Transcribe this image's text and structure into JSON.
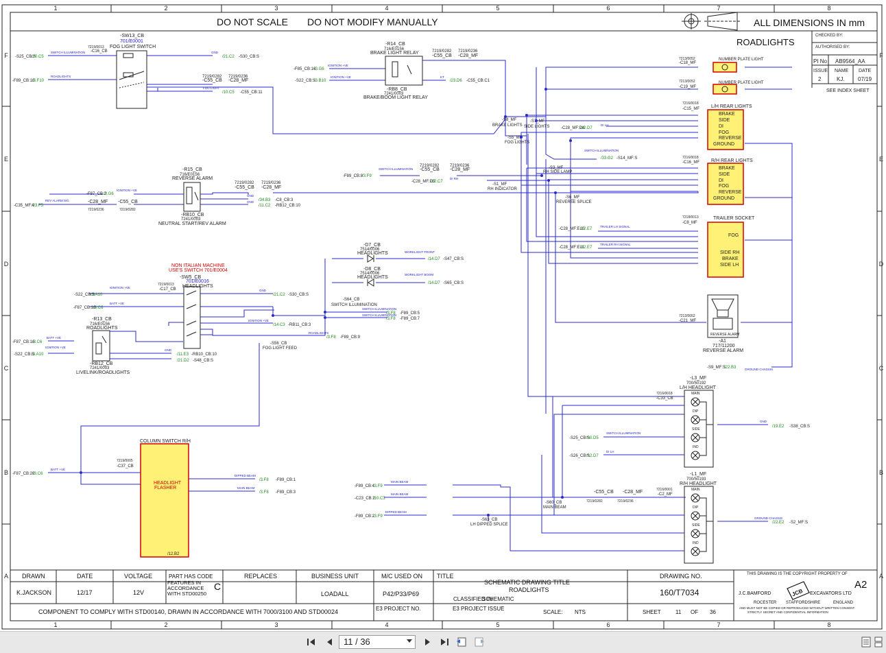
{
  "grid": {
    "cols": [
      "1",
      "2",
      "3",
      "4",
      "5",
      "6",
      "7",
      "8"
    ],
    "rows": [
      "F",
      "E",
      "D",
      "C",
      "B",
      "A"
    ]
  },
  "header": {
    "do_not_scale": "DO NOT SCALE",
    "do_not_modify": "DO NOT MODIFY MANUALLY",
    "all_dims": "ALL DIMENSIONS IN mm"
  },
  "sheet_title": "ROADLIGHTS",
  "right_panel": {
    "checked_by": "CHECKED BY:",
    "authorised_by": "AUTHORISED BY:",
    "pi_no_label": "PI No",
    "pi_no": "AB9564_AA",
    "issue_label": "ISSUE",
    "name_label": "NAME",
    "date_label": "DATE",
    "issue": "2",
    "name": "KJ.",
    "date": "07/19",
    "see_index": "SEE INDEX SHEET"
  },
  "components": {
    "sw13": {
      "ref": "-SW13_CB",
      "part": "701/E0001",
      "name": "FOG LIGHT SWITCH",
      "conn": "7219/0013",
      "plug": "-C16_CB"
    },
    "r14": {
      "ref": "-R14_CB",
      "part": "716/E0156",
      "name": "BRAKE LIGHT RELAY",
      "plug": "-RB8_CB",
      "part2": "7241/0003",
      "name2": "BRAKE/BOOM LIGHT RELAY"
    },
    "r15": {
      "ref": "-R15_CB",
      "part": "716/E0156",
      "name": "REVERSE ALARM",
      "plug": "-RB10_CB",
      "part2": "7241/0003",
      "name2": "NEUTRAL START/REV ALARM"
    },
    "sw5": {
      "ref": "-SW5_CB",
      "part": "701/E0016",
      "name": "HEADLIGHTS",
      "conn": "7219/0013",
      "plug": "-C17_CB",
      "note1": "NON ITALIAN MACHINE",
      "note2": "USE'S SWITCH 701/E0004"
    },
    "r13": {
      "ref": "-R13_CB",
      "part": "716/E0156",
      "name": "ROADLIGHTS",
      "plug": "-RB12_CB",
      "part2": "7241/0003",
      "name2": "LIVELINK/ROADLIGHTS"
    },
    "d7": {
      "ref": "-D7_CB",
      "part": "7514/0006",
      "name": "HEADLIGHTS"
    },
    "d8": {
      "ref": "-D8_CB",
      "part": "7514/0006",
      "name": "HEADLIGHTS"
    },
    "col_switch": {
      "title": "COLUMN SWITCH R/H",
      "name1": "HEADLIGHT",
      "name2": "FLASHER",
      "ref": "/12.B2",
      "conn": "7219/0005",
      "plug": "-C37_CB"
    },
    "c18": {
      "ref": "-C18_MF",
      "conn": "7213/0052",
      "name": "NUMBER PLATE LIGHT"
    },
    "c19": {
      "ref": "-C19_MF",
      "conn": "7213/0052",
      "name": "NUMBER PLATE LIGHT"
    },
    "c15": {
      "ref": "-C15_MF",
      "conn": "7216/0018",
      "name": "L/H REAR LIGHTS",
      "pins": [
        "BRAKE",
        "SIDE",
        "DI",
        "FOG",
        "REVERSE",
        "GROUND"
      ]
    },
    "c16": {
      "ref": "-C16_MF",
      "conn": "7216/0018",
      "name": "R/H REAR LIGHTS",
      "pins": [
        "BRAKE",
        "SIDE",
        "DI",
        "FOG",
        "REVERSE",
        "GROUND"
      ]
    },
    "c8": {
      "ref": "-C8_MF",
      "conn": "7218/0013",
      "name": "TRAILER SOCKET",
      "pins": [
        "FOG",
        "SIDE RH",
        "BRAKE",
        "SIDE LH"
      ]
    },
    "a1": {
      "ref": "-A1",
      "part": "717/11200",
      "name": "REVERSE ALARM",
      "conn": "7212/0052",
      "plug": "-C21_MF",
      "label": "REVERSE ALARM"
    },
    "l3": {
      "ref": "-L3_MF",
      "part": "700/50192",
      "name": "L/H HEADLIGHT",
      "conn": "7216/0018",
      "plug": "-C33_CB",
      "pins": [
        "MAIN",
        "DIP",
        "SIDE",
        "IND"
      ]
    },
    "l1": {
      "ref": "-L1_MF",
      "part": "700/50193",
      "name": "R/H HEADLIGHT",
      "conn": "7216/0001",
      "plug": "-C2_MF",
      "pins": [
        "MAIN",
        "DIP",
        "SIDE",
        "IND"
      ]
    }
  },
  "splices": {
    "s8": "-S8_MF",
    "s8n": "BRAKE LIGHTS",
    "s7": "-S7_MF",
    "s7n": "SIDE LIGHTS",
    "s5": "-S5_MF",
    "s5n": "FOG LIGHTS",
    "s3": "-S3_MF",
    "s3n": "RH SIDE LAMP",
    "s1": "-S1_MF",
    "s1n": "RH INDICATOR",
    "s6": "-S6_MF",
    "s6n": "REVERSE SPLICE",
    "s64": "-S64_CB",
    "s64n": "SWITCH ILLUMINATION",
    "s56": "-S56_CB",
    "s56n": "FOG LIGHT FEED",
    "s60": "-S60_CB",
    "s60n": "MAIN BEAM",
    "s63": "-S63_CB",
    "s63n": "LH DIPPED SPLICE"
  },
  "xrefs": {
    "f_a": "-S25_CB:S",
    "f_a2": "/20.C5",
    "f_b": "-F89_CB:10",
    "f_b2": "/3.F10",
    "f_c": "/21.C2",
    "f_c2": "-S30_CB:S",
    "f_d": "/10.C5",
    "f_d2": "-C55_CB:11",
    "f_e": "-F85_CB:16",
    "f_e2": "/3.G6",
    "f_f": "-S22_CB:S",
    "f_f2": "/3.B10",
    "f_g": "/23.D6",
    "f_g2": "-C55_CB:C1",
    "e_a": "-F89_CB:8",
    "e_a2": "/3.F9",
    "e_b": "-C28_MF:D4",
    "e_b2": "/12.D7",
    "e_c": "/33.G2",
    "e_c2": "-S14_MF:S",
    "e_d": "-C28_MF:D3",
    "e_d2": "/12.C7",
    "e_e": "-F87_CB:2",
    "e_e2": "/3.G6",
    "e_f": "-C35_MF:4",
    "e_f2": "/23.F5",
    "e_g": "/34.B3",
    "e_g2": "-C8_CB:3",
    "e_h": "/11.C2",
    "e_h2": "-RB12_CB:10",
    "d_a": "-C28_MF:E10",
    "d_a2": "/12.E7",
    "d_b": "-C28_MF:E11",
    "d_b2": "/12.E7",
    "d_c": "/14.D7",
    "d_c2": "-S47_CB:S",
    "d_d": "/14.D7",
    "d_d2": "-S65_CB:S",
    "c_a": "-S22_CB:S",
    "c_a2": "/3.A10",
    "c_b": "-F87_CB:16",
    "c_b2": "/3.C6",
    "c_c": "/21.C2",
    "c_c2": "-S30_CB:S",
    "c_d": "/14.C3",
    "c_d2": "-RB11_CB:3",
    "c_e": "/3.F8",
    "c_e2": "-F89_CB:9",
    "c_f": "-F87_CB:16",
    "c_f2": "/3.C6",
    "c_g": "-S22_CB:S",
    "c_g2": "/3.A10",
    "c_h": "/11.E3",
    "c_h2": "-RB10_CB:10",
    "c_i": "/21.D2",
    "c_i2": "-S48_CB:S",
    "c_j": "/3.F8",
    "c_j2": "-F89_CB:5",
    "c_k": "/3.F8",
    "c_k2": "-F89_CB:7",
    "c_l": "-S9_MF:S",
    "c_l2": "/22.B3",
    "b_a": "-S25_CB:S",
    "b_a2": "/20.D5",
    "b_b": "-S26_CB:S",
    "b_b2": "/12.D7",
    "b_c": "/19.E2",
    "b_c2": "-S38_CB:S",
    "b_d": "-F87_CB:20",
    "b_d2": "/3.C6",
    "b_e": "/3.F8",
    "b_e2": "-F89_CB:1",
    "b_f": "/3.F8",
    "b_f2": "-F89_CB:3",
    "b_g": "-F89_CB:4",
    "b_g2": "/3.F9",
    "b_h": "-C23_CB:2",
    "b_h2": "/10.C3",
    "b_i": "-F89_CB:2",
    "b_i2": "/3.F9",
    "b_j": "/22.E2",
    "b_j2": "-S2_MF:S",
    "c55": "-C55_CB",
    "c55c": "7219/0282",
    "c28": "-C28_MF",
    "c28c": "7219/0236"
  },
  "wire_notes": {
    "switch_illum": "SWITCH ILLUMINATION",
    "roadlights": "ROADLIGHTS",
    "gnd": "GND",
    "fog_light": "FOG LIGHT",
    "ignition": "IGNITION +VE",
    "batt": "BATT +VE",
    "rev_alarm_sig": "REV ALARM SIG",
    "lh_signal": "TRAILER LH SIGNAL",
    "rh_signal": "TRAILER RH SIGNAL",
    "worklight_front": "WORKLIGHT FRONT",
    "worklight_boom": "WORKLIGHT BOOM",
    "dipped": "DIPPED BEAM",
    "main_beam": "MAIN BEAM",
    "ground_chassis": "GROUND CHASSIS",
    "dilh": "DI LH",
    "dirh": "DI RH",
    "kt": "KT"
  },
  "title_block": {
    "h_drawn": "DRAWN",
    "h_date": "DATE",
    "h_voltage": "VOLTAGE",
    "h_part": "PART HAS CODE",
    "part_note": "FEATURES IN ACCORDANCE WITH STD00250",
    "part_code": "C",
    "h_replaces": "REPLACES",
    "h_bu": "BUSINESS UNIT",
    "h_mc": "M/C USED ON",
    "h_title": "TITLE",
    "h_drawing": "DRAWING NO.",
    "drawn": "K.JACKSON",
    "date": "12/17",
    "voltage": "12V",
    "bu": "LOADALL",
    "mc": "P42/P33/P69",
    "title1": "SCHEMATIC DRAWING TITLE",
    "title2": "ROADLIGHTS",
    "classified_label": "CLASSIFIED IN",
    "classified": "SCHEMATIC",
    "drawing_no": "160/T7034",
    "comply": "COMPONENT TO COMPLY WITH STD00140, DRAWN IN ACCORDANCE WITH 7000/3100 AND STD00024",
    "e3_project": "E3 PROJECT NO.",
    "e3_issue": "E3 PROJECT ISSUE",
    "scale_label": "SCALE:",
    "scale": "NTS",
    "sheet_label": "SHEET",
    "sheet": "11",
    "of_label": "OF",
    "of": "36",
    "copyright": "THIS DRAWING IS THE COPYRIGHT PROPERTY OF",
    "size": "A2",
    "company1": "J.C.BAMFORD",
    "company2": "EXCAVATORS LTD",
    "addr1": "ROCESTER",
    "addr2": "STAFFORDSHIRE",
    "addr3": "ENGLAND",
    "fine1": "AND MUST NOT BE COPIED OR REPRODUCED WITHOUT WRITTEN CONSENT.",
    "fine2": "STRICTLY SECRET AND CONFIDENTIAL INFORMATION",
    "logo": "JCB"
  },
  "viewer": {
    "page_indicator": "11 / 36"
  },
  "colors": {
    "wire": "#2a2acc",
    "pink": "#cc2233",
    "green": "#1a8a1a",
    "red": "#d40000",
    "blue_text": "#1a1ad0",
    "yellow": "#fff176"
  }
}
